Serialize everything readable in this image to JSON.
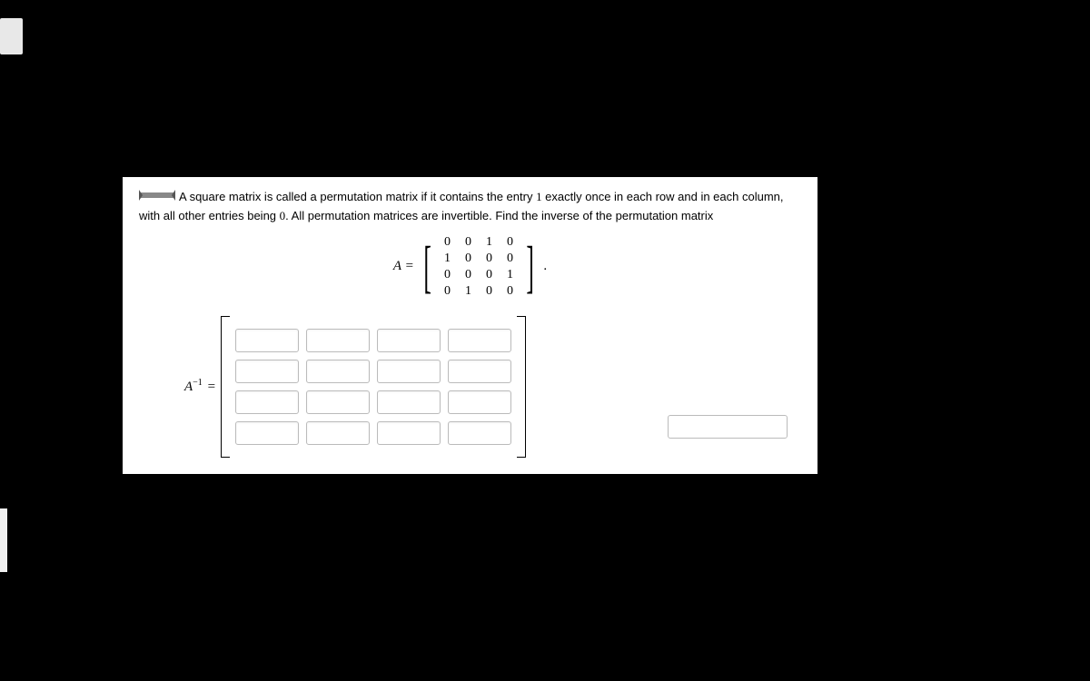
{
  "question": {
    "text_pre": "A square matrix is called a permutation matrix if it contains the entry ",
    "one": "1",
    "text_mid1": " exactly once in each row and in each column, with all other entries being ",
    "zero": "0",
    "text_mid2": ". All permutation matrices are invertible. Find the inverse of the permutation matrix"
  },
  "matrixA": {
    "label": "A =",
    "rows": [
      [
        "0",
        "0",
        "1",
        "0"
      ],
      [
        "1",
        "0",
        "0",
        "0"
      ],
      [
        "0",
        "0",
        "0",
        "1"
      ],
      [
        "0",
        "1",
        "0",
        "0"
      ]
    ],
    "tail": "."
  },
  "answer": {
    "label_base": "A",
    "label_exp": "−1",
    "label_eq": "=",
    "gridRows": 4,
    "gridCols": 4
  }
}
